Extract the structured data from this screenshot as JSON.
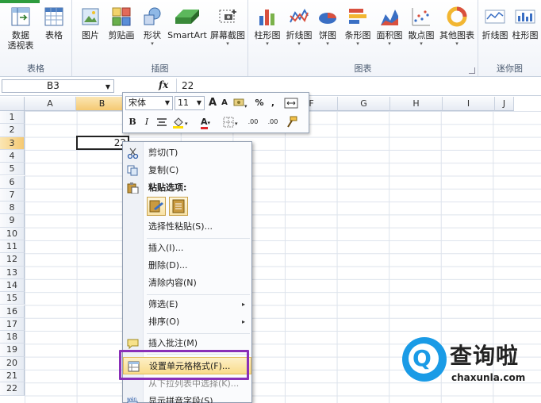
{
  "ribbon": {
    "groups": [
      {
        "label": "表格",
        "buttons": [
          {
            "label": "数据\n透视表",
            "caret": "▾"
          },
          {
            "label": "表格"
          }
        ]
      },
      {
        "label": "插图",
        "buttons": [
          {
            "label": "图片"
          },
          {
            "label": "剪贴画"
          },
          {
            "label": "形状",
            "caret": "▾"
          },
          {
            "label": "SmartArt"
          },
          {
            "label": "屏幕截图",
            "caret": "▾"
          }
        ]
      },
      {
        "label": "图表",
        "buttons": [
          {
            "label": "柱形图",
            "caret": "▾"
          },
          {
            "label": "折线图",
            "caret": "▾"
          },
          {
            "label": "饼图",
            "caret": "▾"
          },
          {
            "label": "条形图",
            "caret": "▾"
          },
          {
            "label": "面积图",
            "caret": "▾"
          },
          {
            "label": "散点图",
            "caret": "▾"
          },
          {
            "label": "其他图表",
            "caret": "▾"
          }
        ]
      },
      {
        "label": "迷你图",
        "buttons": [
          {
            "label": "折线图"
          },
          {
            "label": "柱形图"
          }
        ]
      }
    ]
  },
  "formula_bar": {
    "name_box": "B3",
    "fx": "fx",
    "value": "22"
  },
  "columns": [
    "A",
    "B",
    "C",
    "D",
    "E",
    "F",
    "G",
    "H",
    "I",
    "J"
  ],
  "active_column": "B",
  "rows": [
    "1",
    "2",
    "3",
    "4",
    "5",
    "6",
    "7",
    "8",
    "9",
    "10",
    "11",
    "12",
    "13",
    "14",
    "15",
    "16",
    "17",
    "18",
    "19",
    "20",
    "21",
    "22"
  ],
  "active_row": "3",
  "active_cell": {
    "ref": "B3",
    "value": "22"
  },
  "mini_toolbar": {
    "font": "宋体",
    "size": "11",
    "grow": "A",
    "shrink": "A",
    "percent": "%",
    "comma": ",",
    "bold": "B",
    "italic": "I",
    "font_color": "A",
    "inc_decimal": ".00",
    "dec_decimal": ".00"
  },
  "context_menu": {
    "items": [
      {
        "label": "剪切(T)",
        "icon": "scissors-icon"
      },
      {
        "label": "复制(C)",
        "icon": "copy-icon"
      },
      {
        "label": "粘贴选项:",
        "icon": "paste-icon",
        "bold": true
      },
      {
        "label": "选择性粘贴(S)..."
      },
      {
        "label": "插入(I)..."
      },
      {
        "label": "删除(D)..."
      },
      {
        "label": "清除内容(N)"
      },
      {
        "label": "筛选(E)",
        "submenu": "▸"
      },
      {
        "label": "排序(O)",
        "submenu": "▸"
      },
      {
        "label": "插入批注(M)",
        "icon": "comment-icon"
      },
      {
        "label": "设置单元格格式(F)...",
        "icon": "format-cells-icon",
        "highlighted": true
      },
      {
        "label": "从下拉列表中选择(K)..."
      },
      {
        "label": "显示拼音字段(S)",
        "icon": "phonetic-icon"
      }
    ]
  },
  "watermark": {
    "brand": "查询啦",
    "domain": "chaxunla.com",
    "logo_letter": "Q"
  },
  "colors": {
    "accent_purple": "#8a2fb8",
    "highlight": "#f9dc8b",
    "watermark_blue": "#1a9be6"
  }
}
